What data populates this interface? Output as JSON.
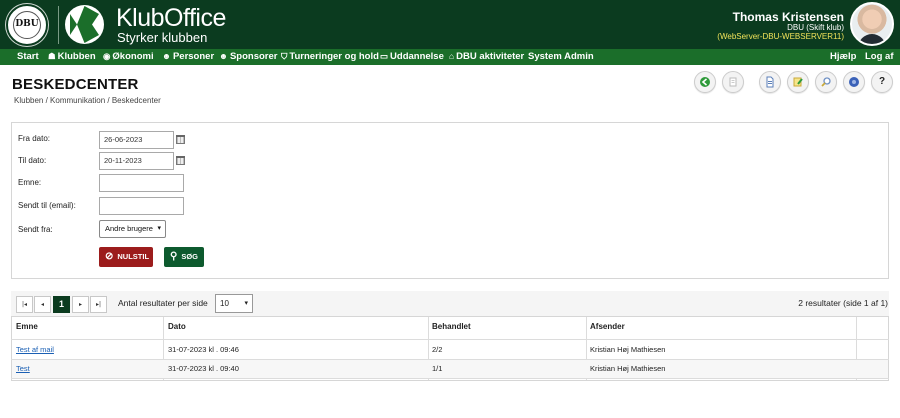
{
  "header": {
    "seal_text": "DBU",
    "brand_title": "KlubOffice",
    "brand_subtitle": "Styrker klubben",
    "user_name": "Thomas Kristensen",
    "user_club": "DBU (Skift klub)",
    "server": "(WebServer-DBU-WEBSERVER11)"
  },
  "nav": {
    "items": [
      {
        "label": "Start",
        "icon": ""
      },
      {
        "label": "Klubben",
        "icon": "people-icon"
      },
      {
        "label": "Økonomi",
        "icon": "coin-icon"
      },
      {
        "label": "Personer",
        "icon": "person-icon"
      },
      {
        "label": "Sponsorer",
        "icon": "sponsor-icon"
      },
      {
        "label": "Turneringer og hold",
        "icon": "shield-icon"
      },
      {
        "label": "Uddannelse",
        "icon": "monitor-icon"
      },
      {
        "label": "DBU aktiviteter",
        "icon": "graduation-cap-icon"
      },
      {
        "label": "System Admin",
        "icon": ""
      }
    ],
    "help": "Hjælp",
    "logout": "Log af"
  },
  "page": {
    "title": "BESKEDCENTER",
    "breadcrumb": "Klubben / Kommunikation / Beskedcenter"
  },
  "toolbar_icons": [
    "back-icon",
    "copy-icon",
    "document-icon",
    "edit-icon",
    "search-icon",
    "help-icon",
    "question-icon"
  ],
  "toolbar_question_glyph": "?",
  "filter": {
    "from_date_label": "Fra dato:",
    "from_date_value": "26-06-2023",
    "to_date_label": "Til dato:",
    "to_date_value": "20-11-2023",
    "subject_label": "Emne:",
    "subject_value": "",
    "sent_to_label": "Sendt til (email):",
    "sent_to_value": "",
    "sent_from_label": "Sendt fra:",
    "sent_from_value": "Andre brugere",
    "reset_label": "NULSTIL",
    "search_label": "SØG"
  },
  "results": {
    "pager": {
      "first": "|◂",
      "prev": "◂",
      "current": "1",
      "next": "▸",
      "last": "▸|"
    },
    "per_page_label": "Antal resultater per side",
    "per_page_value": "10",
    "count_text": "2 resultater (side 1 af 1)",
    "columns": [
      "Emne",
      "Dato",
      "Behandlet",
      "Afsender"
    ],
    "rows": [
      {
        "subject": "Test af mail",
        "date": "31-07-2023 kl . 09:46",
        "handled": "2/2",
        "sender": "Kristian Høj Mathiesen"
      },
      {
        "subject": "Test",
        "date": "31-07-2023 kl . 09:40",
        "handled": "1/1",
        "sender": "Kristian Høj Mathiesen"
      }
    ]
  },
  "colors": {
    "header_bg": "#0b3b1f",
    "nav_bg": "#1b6e2a",
    "reset_button": "#9c1c1c",
    "search_button": "#0d5a2e",
    "server_text": "#f2e35a",
    "link": "#1a5fb4"
  }
}
